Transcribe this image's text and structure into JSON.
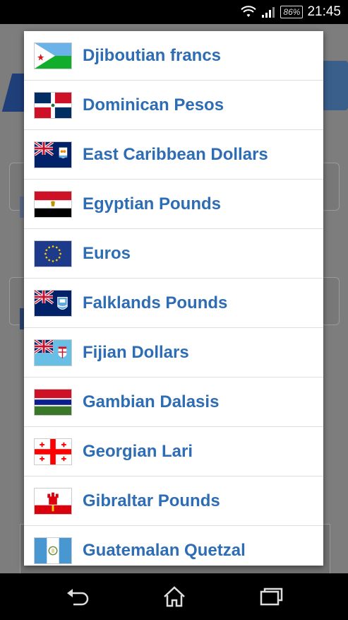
{
  "status_bar": {
    "time": "21:45",
    "battery": "86%",
    "icons": [
      "wifi-icon",
      "signal-icon",
      "battery-icon"
    ]
  },
  "currency_list": [
    {
      "label": "Djiboutian francs",
      "flag": "djibouti-flag-icon"
    },
    {
      "label": "Dominican Pesos",
      "flag": "dominican-republic-flag-icon"
    },
    {
      "label": "East Caribbean Dollars",
      "flag": "anguilla-flag-icon"
    },
    {
      "label": "Egyptian Pounds",
      "flag": "egypt-flag-icon"
    },
    {
      "label": "Euros",
      "flag": "eu-flag-icon"
    },
    {
      "label": "Falklands Pounds",
      "flag": "falklands-flag-icon"
    },
    {
      "label": "Fijian Dollars",
      "flag": "fiji-flag-icon"
    },
    {
      "label": "Gambian Dalasis",
      "flag": "gambia-flag-icon"
    },
    {
      "label": "Georgian Lari",
      "flag": "georgia-flag-icon"
    },
    {
      "label": "Gibraltar Pounds",
      "flag": "gibraltar-flag-icon"
    },
    {
      "label": "Guatemalan Quetzal",
      "flag": "guatemala-flag-icon"
    }
  ],
  "nav_bar": {
    "icons": [
      "back-icon",
      "home-icon",
      "recent-apps-icon"
    ]
  },
  "colors": {
    "label_text": "#2e6db3",
    "dialog_bg": "#ffffff",
    "scrim": "#7d7d7d"
  }
}
